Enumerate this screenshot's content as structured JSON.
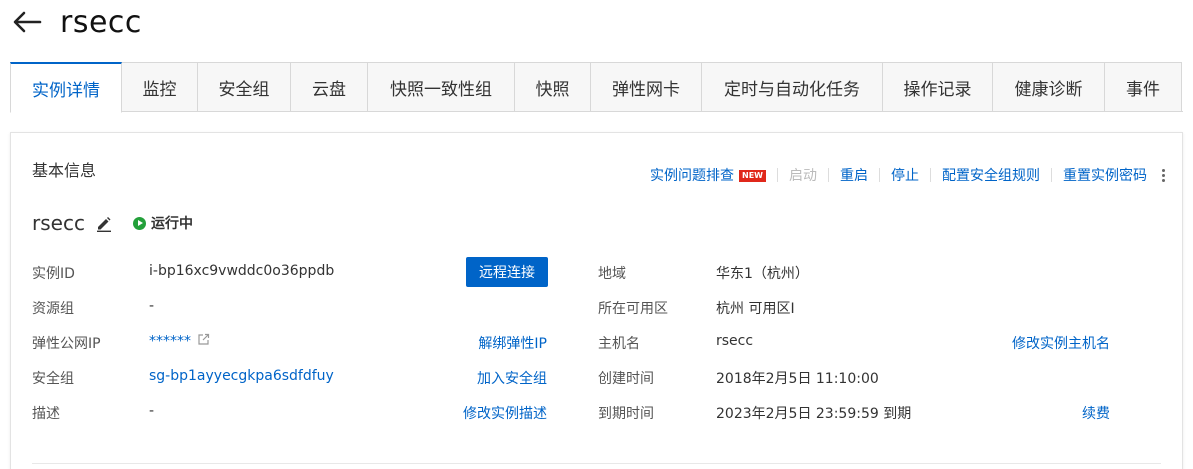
{
  "page": {
    "title": "rsecc",
    "back_icon": "arrow-left-icon"
  },
  "tabs": [
    {
      "label": "实例详情",
      "active": true
    },
    {
      "label": "监控"
    },
    {
      "label": "安全组"
    },
    {
      "label": "云盘"
    },
    {
      "label": "快照一致性组"
    },
    {
      "label": "快照"
    },
    {
      "label": "弹性网卡"
    },
    {
      "label": "定时与自动化任务"
    },
    {
      "label": "操作记录"
    },
    {
      "label": "健康诊断"
    },
    {
      "label": "事件"
    }
  ],
  "basic": {
    "title": "基本信息",
    "actions": {
      "troubleshoot": "实例问题排查",
      "new_badge": "NEW",
      "start": "启动",
      "restart": "重启",
      "stop": "停止",
      "config_sg": "配置安全组规则",
      "reset_pwd": "重置实例密码"
    },
    "instance_name": "rsecc",
    "status": "运行中",
    "fields": {
      "instance_id_label": "实例ID",
      "instance_id": "i-bp16xc9vwddc0o36ppdb",
      "remote_connect": "远程连接",
      "resource_group_label": "资源组",
      "resource_group": "-",
      "eip_label": "弹性公网IP",
      "eip": "******",
      "unbind_eip": "解绑弹性IP",
      "sg_label": "安全组",
      "sg": "sg-bp1ayyecgkpa6sdfdfuy",
      "join_sg": "加入安全组",
      "desc_label": "描述",
      "desc": "-",
      "modify_desc": "修改实例描述",
      "region_label": "地域",
      "region": "华东1（杭州）",
      "zone_label": "所在可用区",
      "zone": "杭州 可用区I",
      "hostname_label": "主机名",
      "hostname": "rsecc",
      "modify_hostname": "修改实例主机名",
      "created_label": "创建时间",
      "created": "2018年2月5日 11:10:00",
      "expire_label": "到期时间",
      "expire": "2023年2月5日 23:59:59 到期",
      "renew": "续费"
    }
  },
  "colors": {
    "accent": "#0064c8",
    "running": "#23a03a",
    "new_badge": "#e0281b"
  }
}
